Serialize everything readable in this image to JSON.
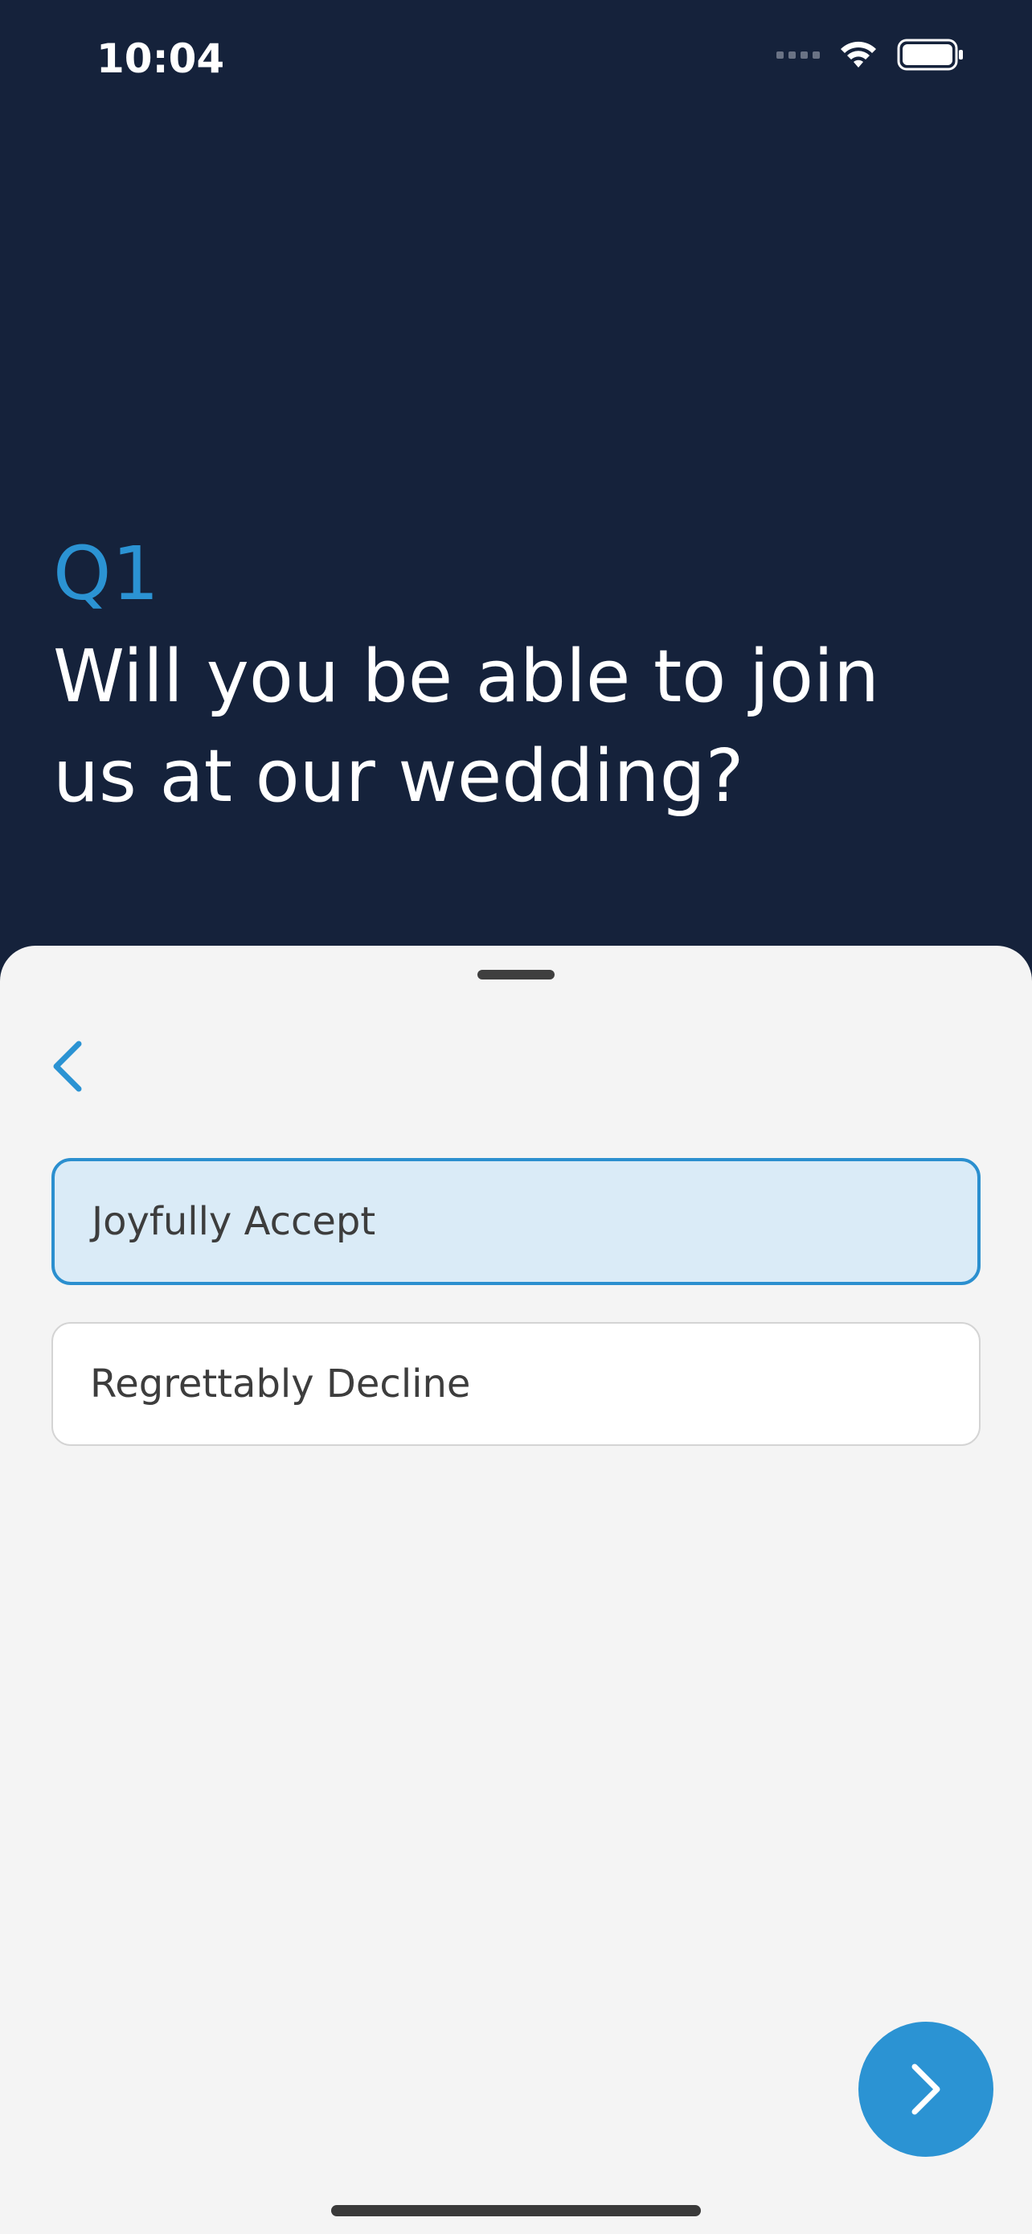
{
  "status_bar": {
    "time": "10:04",
    "icons": [
      "cellular-signal-icon",
      "wifi-icon",
      "battery-icon"
    ]
  },
  "question": {
    "number": "Q1",
    "text": "Will you be able to join us at our wedding?"
  },
  "sheet": {
    "back_icon": "chevron-left-icon",
    "options": [
      {
        "label": "Joyfully Accept",
        "selected": true
      },
      {
        "label": "Regrettably Decline",
        "selected": false
      }
    ],
    "next_icon": "chevron-right-icon"
  },
  "colors": {
    "background": "#15223b",
    "accent": "#2b93d3",
    "sheet": "#f4f4f4",
    "selected_fill": "#daebf7",
    "selected_border": "#2b8fcf"
  }
}
